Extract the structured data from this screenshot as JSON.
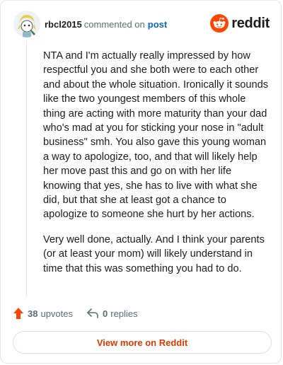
{
  "header": {
    "username": "rbcl2015",
    "action_text": "commented on",
    "post_link": "post",
    "brand_name": "reddit",
    "avatar_icon": "snoo-avatar-icon",
    "brand_icon": "reddit-logo-icon"
  },
  "comment": {
    "paragraphs": [
      "NTA and I'm actually really impressed by how respectful you and she both were to each other and about the whole situation. Ironically it sounds like the two youngest members of this whole thing are acting with more maturity than your dad who's mad at you for sticking your nose in \"adult business\" smh. You also gave this young woman a way to apologize, too, and that will likely help her move past this and go on with her life knowing that yes, she has to live with what she did, but that she at least got a chance to apologize to someone she hurt by her actions.",
      "Very well done, actually. And I think your parents (or at least your mom) will likely understand in time that this was something you had to do."
    ]
  },
  "footer": {
    "upvotes_count": "38",
    "upvotes_label": "upvotes",
    "replies_count": "0",
    "replies_label": "replies",
    "upvote_icon": "upvote-arrow-icon",
    "reply_icon": "reply-arrow-icon"
  },
  "view_more_label": "View more on Reddit",
  "colors": {
    "accent": "#d93900",
    "upvote": "#ff4500",
    "link": "#0a66c2",
    "muted": "#576f76",
    "border": "#e5e6e8"
  }
}
